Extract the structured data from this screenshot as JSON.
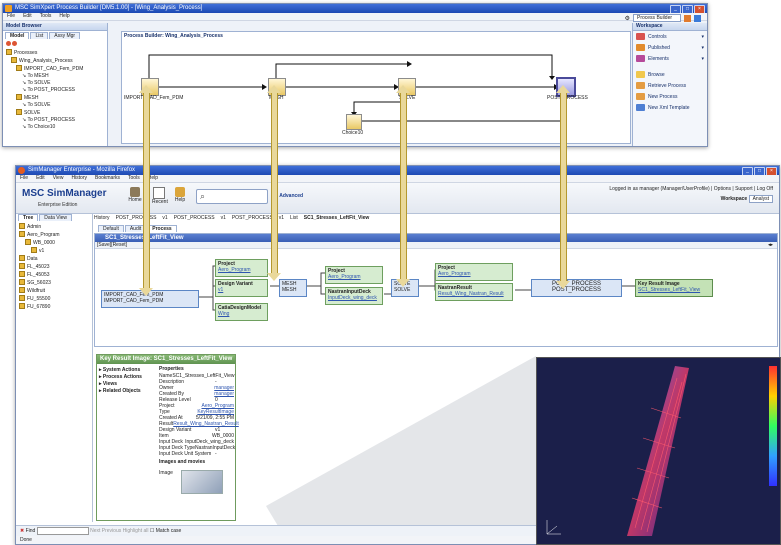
{
  "colors": {
    "titlebar": "#1d49b3",
    "flow_blue": "#dbe6f6",
    "flow_green": "#d6ecd0",
    "arrow": "#e9d89a",
    "header_green": "#6fa35f",
    "viz_bg": "#1b1f4a"
  },
  "builder": {
    "title": "MSC SimXpert Process Builder [DM5.1.00] - [Wing_Analysis_Process]",
    "menu": [
      "File",
      "Edit",
      "Tools",
      "Help"
    ],
    "toolbar_combo": "Process Builder",
    "model_browser": {
      "title": "Model Browser",
      "tabs": [
        "Model",
        "List",
        "Assy Mgr"
      ],
      "tree": [
        "Processes",
        "Wing_Analysis_Process",
        "IMPORT_CAD_Fem_PDM",
        "To MESH",
        "To SOLVE",
        "To POST_PROCESS",
        "MESH",
        "To SOLVE",
        "SOLVE",
        "To POST_PROCESS",
        "To Choice10"
      ]
    },
    "canvas_title": "Process Builder: Wing_Analysis_Process",
    "nodes": [
      "IMPORT_CAD_Fem_PDM",
      "MESH",
      "SOLVE",
      "POST_PROCESS",
      "Choice10"
    ],
    "workspace": {
      "title": "Workspace",
      "combos": [
        "Controls",
        "Published",
        "Elements"
      ],
      "actions": [
        "Browse",
        "Retrieve Process",
        "New Process",
        "New Xml Template"
      ]
    }
  },
  "manager": {
    "title": "SimManager Enterprise - Mozilla Firefox",
    "menu": [
      "File",
      "Edit",
      "View",
      "History",
      "Bookmarks",
      "Tools",
      "Help"
    ],
    "logo": "MSC SimManager",
    "logo_sub": "Enterprise Edition",
    "toolbar": [
      "Home",
      "Recent",
      "Help"
    ],
    "search_label": "Advanced",
    "login_text": "Logged in as manager (Manager/UserProfile) | Options | Support | Log Off",
    "workspace_label": "Workspace",
    "workspace_value": "Analyst",
    "history_items": [
      "History",
      "POST_PROCESS",
      "v1",
      "POST_PROCESS",
      "v1",
      "POST_PROCESS",
      "v1",
      "List",
      "SC1_Stresses_LeftFit_View"
    ],
    "left_tabs": [
      "Tree",
      "Data View"
    ],
    "left_tree": [
      "Admin",
      "Aero_Program",
      "WB_0000",
      "v1",
      "Data",
      "FL_45023",
      "FL_45053",
      "SG_56023",
      "Wildfruit",
      "FU_55500",
      "FU_67890"
    ],
    "main_tabs": [
      "Default",
      "Audit",
      "Process"
    ],
    "flow_title": "SC1_Stresses_LeftFit_View",
    "flow_toolbar": "[Save][Reset]",
    "flow_boxes": {
      "import": {
        "title": "IMPORT_CAD_Fem_PDM",
        "sub": "IMPORT_CAD_Fem_PDM"
      },
      "project1": {
        "title": "Project",
        "sub": "Aero_Program"
      },
      "design_variant": {
        "title": "Design Variant",
        "sub": "v1"
      },
      "cad_model": {
        "title": "CatiaDesignModel",
        "sub": "Wing"
      },
      "mesh": {
        "title": "MESH",
        "sub": "MESH"
      },
      "project2": {
        "title": "Project",
        "sub": "Aero_Program"
      },
      "nastran_deck": {
        "title": "NastranInputDeck",
        "sub": "InputDeck_wing_deck"
      },
      "solve": {
        "title": "SOLVE",
        "sub": "SOLVE"
      },
      "project3": {
        "title": "Project",
        "sub": "Aero_Program"
      },
      "nastran_result": {
        "title": "NastranResult",
        "sub": "Result_Wing_Nastran_Result"
      },
      "post": {
        "title": "POST_PROCESS",
        "sub": "POST_PROCESS"
      },
      "key_result": {
        "title": "Key Result Image",
        "sub": "SC1_Stresses_LeftFit_View"
      }
    },
    "detail": {
      "title": "Key Result Image: SC1_Stresses_LeftFit_View",
      "actions": [
        "System Actions",
        "Process Actions",
        "Views",
        "Related Objects"
      ],
      "props_header": "Properties",
      "props": [
        {
          "k": "Name",
          "v": "SC1_Stresses_LeftFit_View",
          "link": false
        },
        {
          "k": "Description",
          "v": "-",
          "link": false
        },
        {
          "k": "Owner",
          "v": "manager",
          "link": true
        },
        {
          "k": "Created By",
          "v": "manager",
          "link": true
        },
        {
          "k": "Release Level",
          "v": "0",
          "link": false
        },
        {
          "k": "Project",
          "v": "Aero_Program",
          "link": true
        },
        {
          "k": "Type",
          "v": "KeyResultImage",
          "link": true
        },
        {
          "k": "Created At",
          "v": "5/21/09, 2:55 PM",
          "link": false
        },
        {
          "k": "Result",
          "v": "Result_Wing_Nastran_Result",
          "link": true
        },
        {
          "k": "Design Variant",
          "v": "v1",
          "link": false
        },
        {
          "k": "Item",
          "v": "WB_0000",
          "link": false
        },
        {
          "k": "Input Deck",
          "v": "InputDeck_wing_deck",
          "link": false
        },
        {
          "k": "Input Deck Type",
          "v": "NastranInputDeck",
          "link": false
        },
        {
          "k": "Input Deck Unit System",
          "v": "-",
          "link": false
        }
      ],
      "images_header": "Images and movies",
      "image_label": "Image"
    },
    "find_label": "Find",
    "find_options": [
      "Next",
      "Previous",
      "Highlight all",
      "Match case"
    ],
    "status": "Done"
  }
}
